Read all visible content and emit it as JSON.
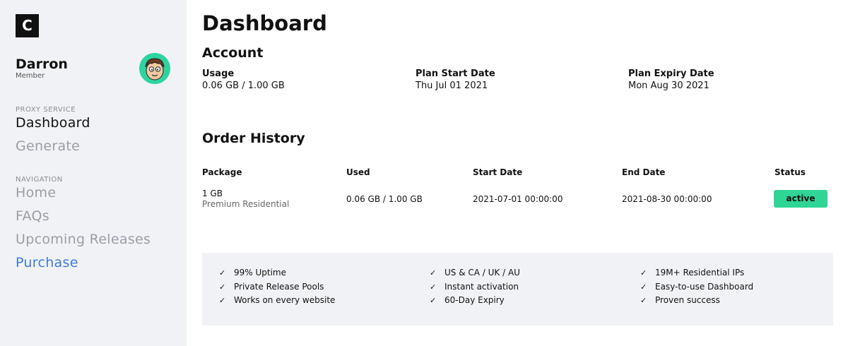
{
  "sidebar": {
    "logo": "C",
    "user": {
      "name": "Darron",
      "role": "Member"
    },
    "sections": [
      {
        "label": "PROXY SERVICE",
        "items": [
          {
            "label": "Dashboard"
          },
          {
            "label": "Generate"
          }
        ]
      },
      {
        "label": "NAVIGATION",
        "items": [
          {
            "label": "Home"
          },
          {
            "label": "FAQs"
          },
          {
            "label": "Upcoming Releases"
          },
          {
            "label": "Purchase"
          }
        ]
      }
    ]
  },
  "main": {
    "title": "Dashboard",
    "account": {
      "heading": "Account",
      "usage_label": "Usage",
      "usage_value": "0.06 GB / 1.00 GB",
      "start_label": "Plan Start Date",
      "start_value": "Thu Jul 01 2021",
      "expiry_label": "Plan Expiry Date",
      "expiry_value": "Mon Aug 30 2021"
    },
    "orders": {
      "heading": "Order History",
      "columns": [
        "Package",
        "Used",
        "Start Date",
        "End Date",
        "Status"
      ],
      "rows": [
        {
          "package": "1 GB",
          "package_type": "Premium Residential",
          "used": "0.06 GB / 1.00 GB",
          "start": "2021-07-01 00:00:00",
          "end": "2021-08-30 00:00:00",
          "status": "active"
        }
      ]
    },
    "features": [
      [
        "99% Uptime",
        "Private Release Pools",
        "Works on every website"
      ],
      [
        "US & CA / UK / AU",
        "Instant activation",
        "60-Day Expiry"
      ],
      [
        "19M+ Residential IPs",
        "Easy-to-use Dashboard",
        "Proven success"
      ]
    ]
  },
  "colors": {
    "accent": "#3f7be0",
    "status_active": "#2fd595",
    "sidebar_bg": "#f1f2f5"
  }
}
